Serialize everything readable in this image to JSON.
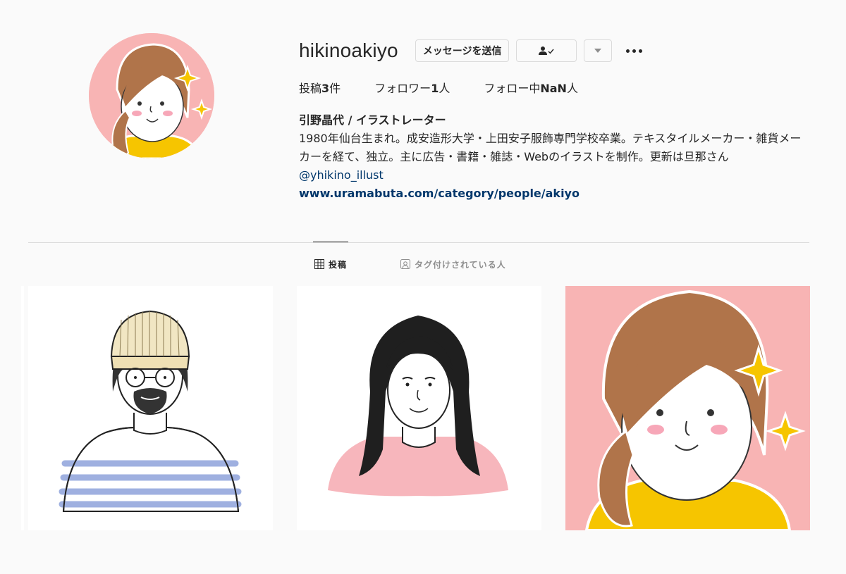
{
  "profile": {
    "username": "hikinoakiyo",
    "message_button": "メッセージを送信",
    "follow_status_icon": "person-check-icon",
    "dropdown_icon": "triangle-down-icon",
    "more_icon": "ellipsis-icon"
  },
  "stats": {
    "posts_prefix": "投稿",
    "posts_count": "3",
    "posts_suffix": "件",
    "followers_prefix": "フォロワー",
    "followers_count": "1",
    "followers_suffix": "人",
    "following_prefix": "フォロー中",
    "following_count": "NaN",
    "following_suffix": "人"
  },
  "bio": {
    "full_name": "引野晶代 / イラストレーター",
    "text": "1980年仙台生まれ。成安造形大学・上田安子服飾専門学校卒業。テキスタイルメーカー・雑貨メーカーを経て、独立。主に広告・書籍・雑誌・Webのイラストを制作。更新は旦那さん ",
    "mention": "@yhikino_illust",
    "website": "www.uramabuta.com/category/people/akiyo"
  },
  "tabs": {
    "posts": "投稿",
    "posts_icon": "grid-icon",
    "tagged": "タグ付けされている人",
    "tagged_icon": "tag-person-icon"
  },
  "colors": {
    "background": "#fafafa",
    "link": "#00376b",
    "avatar_bg": "#f8b4b4",
    "shirt_yellow": "#f6c500",
    "hair_brown": "#b0744a"
  }
}
